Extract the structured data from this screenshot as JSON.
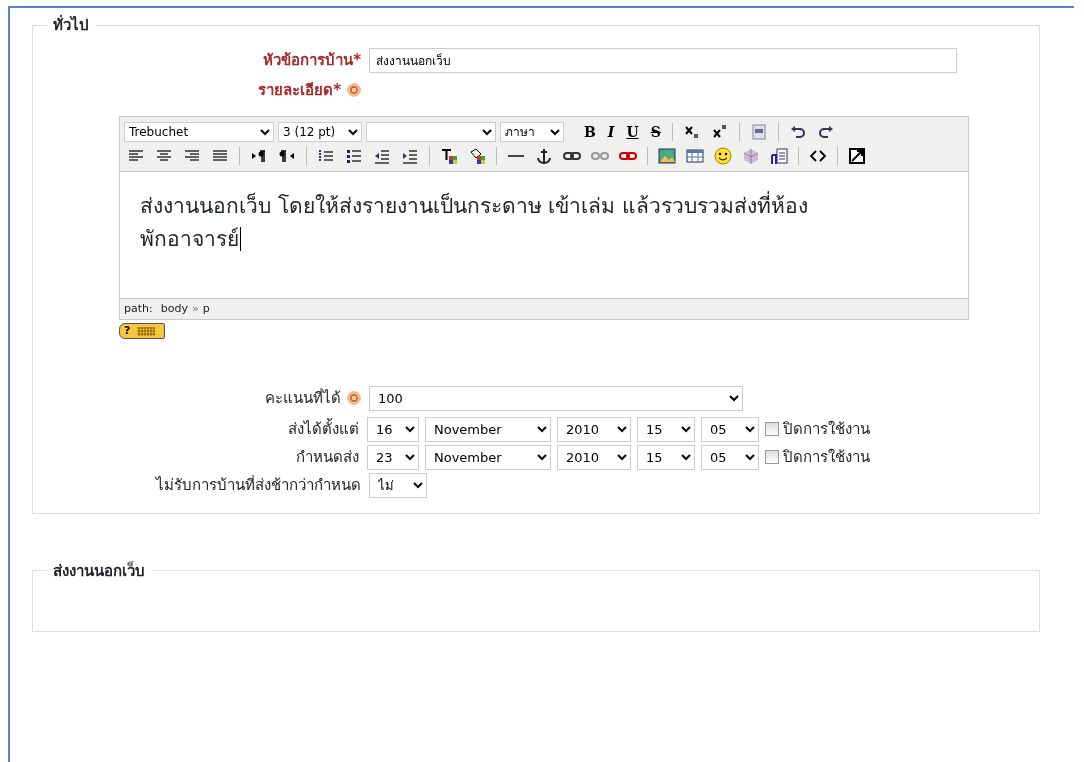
{
  "sections": [
    {
      "legend": "ทั่วไป"
    },
    {
      "legend": "ส่งงานนอกเว็บ"
    }
  ],
  "title_field": {
    "label": "หัวข้อการบ้าน*",
    "value": "ส่งงานนอกเว็บ"
  },
  "description": {
    "label": "รายละเอียด*"
  },
  "editor": {
    "selects": [
      {
        "kind": "font",
        "value": "Trebuchet"
      },
      {
        "kind": "size",
        "value": "3 (12 pt)"
      },
      {
        "kind": "language",
        "value": "ภาษา"
      }
    ],
    "format_buttons": [
      "B",
      "I",
      "U",
      "S"
    ],
    "content": "ส่งงานนอกเว็บ โดยให้ส่งรายงานเป็นกระดาษ เข้าเล่ม แล้วรวบรวมส่งที่ห้องพักอาจารย์",
    "path_label": "path:",
    "path": [
      "body",
      "p"
    ],
    "path_separator": "»",
    "help_key": "?"
  },
  "grade": {
    "label": "คะแนนที่ได้",
    "value": "100"
  },
  "dates": [
    {
      "label": "ส่งได้ตั้งแต่",
      "day": "16",
      "month": "November",
      "year": "2010",
      "hour": "15",
      "minute": "05",
      "disable_label": "ปิดการใช้งาน",
      "checked": false
    },
    {
      "label": "กำหนดส่ง",
      "day": "23",
      "month": "November",
      "year": "2010",
      "hour": "15",
      "minute": "05",
      "disable_label": "ปิดการใช้งาน",
      "checked": false
    }
  ],
  "late": {
    "label": "ไม่รับการบ้านที่ส่งช้ากว่ากำหนด",
    "value": "ไม่"
  }
}
